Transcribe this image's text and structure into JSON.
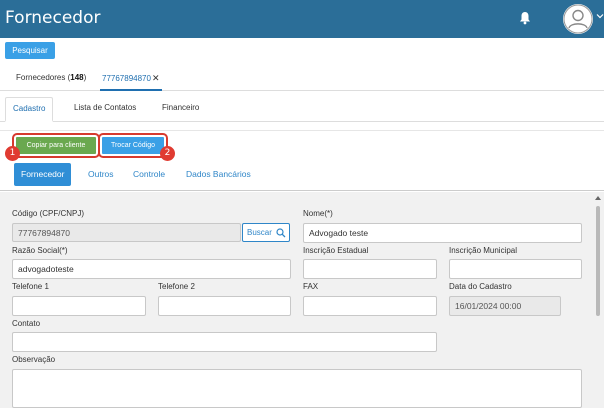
{
  "header": {
    "title": "Fornecedor"
  },
  "toolbar": {
    "pesquisar_label": "Pesquisar"
  },
  "record_tabs": {
    "list_label": "Fornecedores (",
    "list_count": "148",
    "list_close_paren": ")",
    "current_label": "77767894870",
    "close_glyph": "✕"
  },
  "section_tabs": [
    "Cadastro",
    "Lista de Contatos",
    "Financeiro"
  ],
  "actions": {
    "copy_label": "Copiar para cliente",
    "swap_label": "Trocar Código",
    "badge1": "1",
    "badge2": "2"
  },
  "sub_tabs": [
    "Fornecedor",
    "Outros",
    "Controle",
    "Dados Bancários"
  ],
  "form": {
    "codigo_label": "Código (CPF/CNPJ)",
    "codigo_value": "77767894870",
    "buscar_label": "Buscar",
    "nome_label": "Nome(*)",
    "nome_value": "Advogado teste",
    "razao_label": "Razão Social(*)",
    "razao_value": "advogadoteste",
    "insc_estadual_label": "Inscrição Estadual",
    "insc_estadual_value": "",
    "insc_municipal_label": "Inscrição Municipal",
    "insc_municipal_value": "",
    "telefone1_label": "Telefone 1",
    "telefone1_value": "",
    "telefone2_label": "Telefone 2",
    "telefone2_value": "",
    "fax_label": "FAX",
    "fax_value": "",
    "data_cadastro_label": "Data do Cadastro",
    "data_cadastro_value": "16/01/2024 00:00",
    "contato_label": "Contato",
    "contato_value": "",
    "observacao_label": "Observação",
    "observacao_value": ""
  },
  "colors": {
    "header_bg": "#2b6e98",
    "primary_blue": "#3aa0e6",
    "green_button": "#6aa84f",
    "highlight_red": "#d73a2e"
  }
}
